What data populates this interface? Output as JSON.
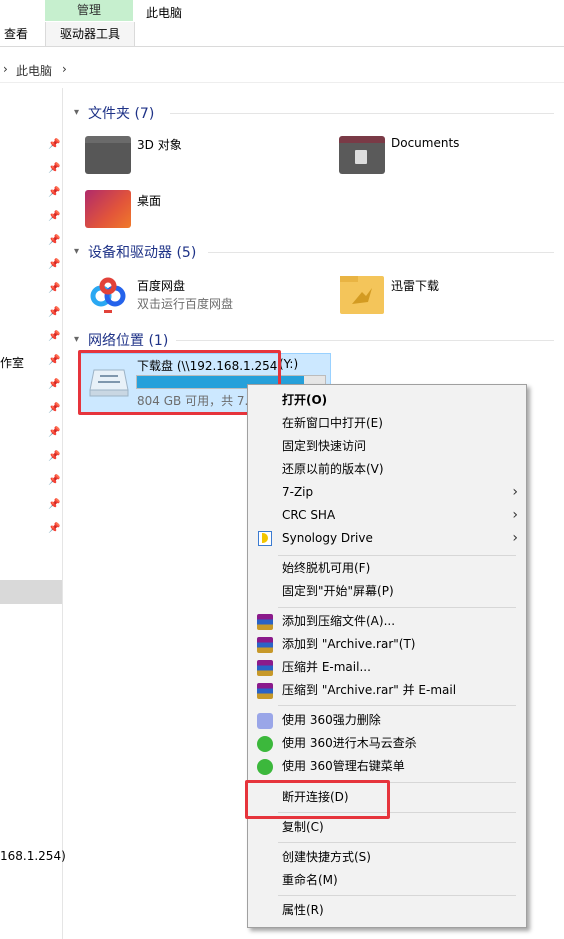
{
  "ribbon": {
    "context_header": "管理",
    "tab_view": "查看",
    "tab_drive_tools": "驱动器工具",
    "tab_this_pc": "此电脑"
  },
  "address": {
    "separator1": "›",
    "location": "此电脑",
    "separator2": "›"
  },
  "nav": {
    "partial_label": "作室",
    "partial_ip": "168.1.254)"
  },
  "folders": {
    "header": "文件夹 (7)",
    "items": [
      {
        "label": "3D 对象",
        "icon": "folder-3d-icon"
      },
      {
        "label": "Documents",
        "icon": "folder-documents-icon"
      },
      {
        "label": "桌面",
        "icon": "folder-desktop-icon"
      }
    ]
  },
  "devices": {
    "header": "设备和驱动器 (5)",
    "items": [
      {
        "label": "百度网盘",
        "sub": "双击运行百度网盘",
        "icon": "baidu-netdisk-icon"
      },
      {
        "label": "迅雷下载",
        "icon": "xunlei-folder-icon"
      }
    ]
  },
  "network": {
    "header": "网络位置 (1)",
    "drive_label": "下载盘 (\\\\192.168.1.254)",
    "drive_letter": "(Y:)",
    "drive_free": "804 GB 可用，共 7.",
    "usage_fraction": 0.89
  },
  "context_menu": {
    "open": "打开(O)",
    "open_new_window": "在新窗口中打开(E)",
    "pin_quick_access": "固定到快速访问",
    "restore_versions": "还原以前的版本(V)",
    "seven_zip": "7-Zip",
    "crc_sha": "CRC SHA",
    "synology_drive": "Synology Drive",
    "always_offline": "始终脱机可用(F)",
    "pin_start": "固定到\"开始\"屏幕(P)",
    "add_archive": "添加到压缩文件(A)...",
    "add_archive_rar": "添加到 \"Archive.rar\"(T)",
    "compress_email": "压缩并 E-mail...",
    "compress_rar_email": "压缩到 \"Archive.rar\" 并 E-mail",
    "force_delete_360": "使用 360强力删除",
    "scan_360": "使用 360进行木马云查杀",
    "manage_360": "使用 360管理右键菜单",
    "disconnect": "断开连接(D)",
    "copy": "复制(C)",
    "create_shortcut": "创建快捷方式(S)",
    "rename": "重命名(M)",
    "properties": "属性(R)"
  },
  "colors": {
    "accent": "#26a0da",
    "selection": "#cce8ff",
    "highlight_box": "#e6343c",
    "group_header": "#1e3287"
  }
}
